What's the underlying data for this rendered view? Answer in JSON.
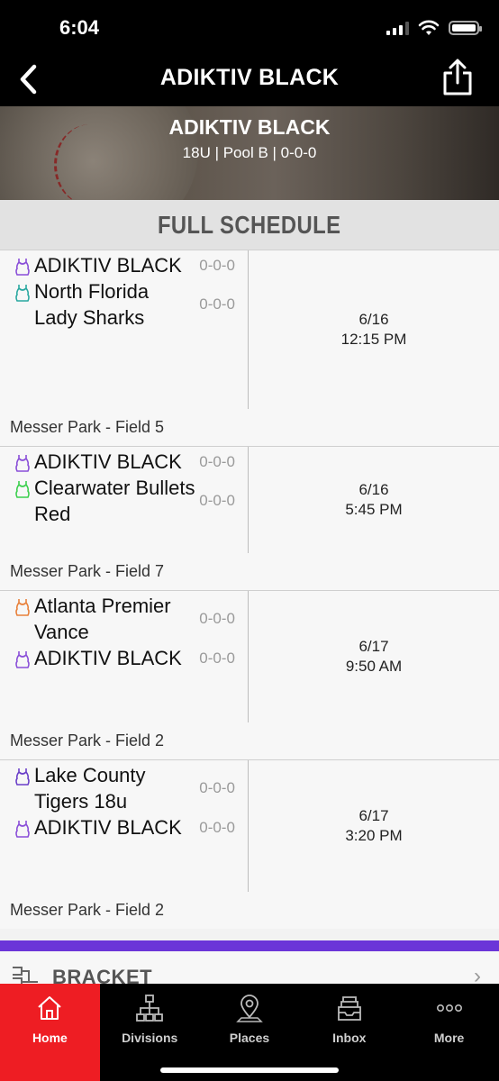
{
  "status_bar": {
    "time": "6:04"
  },
  "nav": {
    "title": "ADIKTIV BLACK"
  },
  "banner": {
    "title": "ADIKTIV BLACK",
    "subtitle": "18U | Pool B | 0-0-0"
  },
  "section": {
    "title": "FULL SCHEDULE"
  },
  "games": [
    {
      "team1": {
        "name": "ADIKTIV BLACK",
        "score": "0-0-0",
        "color": "#8a4fd8"
      },
      "team2": {
        "name": "North Florida Lady Sharks",
        "score": "0-0-0",
        "color": "#2aa8a0"
      },
      "date": "6/16",
      "time": "12:15 PM",
      "venue": "Messer Park - Field 5"
    },
    {
      "team1": {
        "name": "ADIKTIV BLACK",
        "score": "0-0-0",
        "color": "#8a4fd8"
      },
      "team2": {
        "name": "Clearwater Bullets Red",
        "score": "0-0-0",
        "color": "#3ccf4e"
      },
      "date": "6/16",
      "time": "5:45 PM",
      "venue": "Messer Park - Field 7"
    },
    {
      "team1": {
        "name": "Atlanta Premier Vance",
        "score": "0-0-0",
        "color": "#e8803a"
      },
      "team2": {
        "name": "ADIKTIV BLACK",
        "score": "0-0-0",
        "color": "#8a4fd8"
      },
      "date": "6/17",
      "time": "9:50 AM",
      "venue": "Messer Park - Field 2"
    },
    {
      "team1": {
        "name": "Lake County Tigers 18u",
        "score": "0-0-0",
        "color": "#6a3fc8"
      },
      "team2": {
        "name": "ADIKTIV BLACK",
        "score": "0-0-0",
        "color": "#8a4fd8"
      },
      "date": "6/17",
      "time": "3:20 PM",
      "venue": "Messer Park - Field 2"
    }
  ],
  "bracket": {
    "label": "BRACKET"
  },
  "tabs": [
    {
      "label": "Home",
      "icon": "home-icon",
      "active": true
    },
    {
      "label": "Divisions",
      "icon": "divisions-icon",
      "active": false
    },
    {
      "label": "Places",
      "icon": "map-pin-icon",
      "active": false
    },
    {
      "label": "Inbox",
      "icon": "inbox-icon",
      "active": false
    },
    {
      "label": "More",
      "icon": "more-icon",
      "active": false
    }
  ],
  "colors": {
    "accent_red": "#ee1d23",
    "accent_purple": "#6b35d8"
  }
}
